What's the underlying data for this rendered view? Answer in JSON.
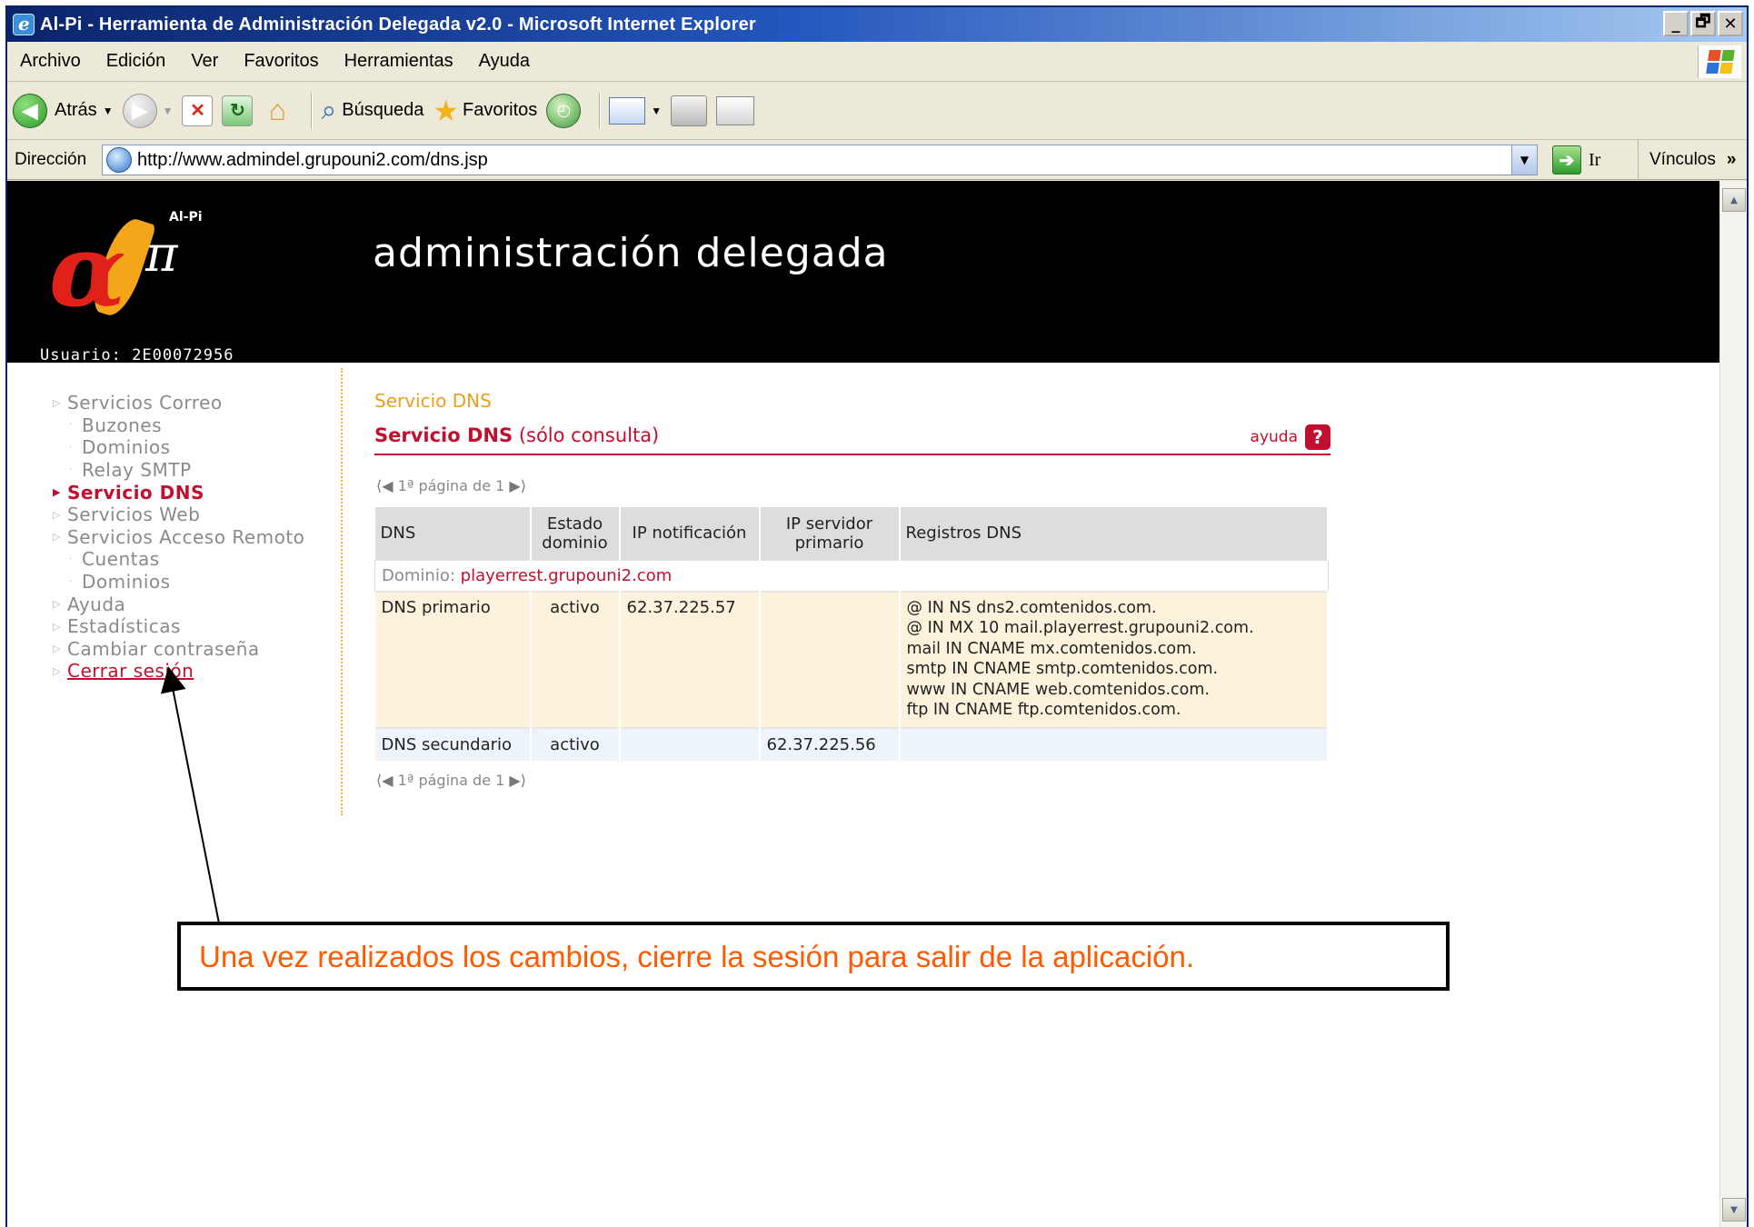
{
  "window": {
    "title": "Al-Pi - Herramienta de Administración Delegada v2.0 - Microsoft Internet Explorer",
    "controls": [
      "_",
      "🗗",
      "✕"
    ]
  },
  "menu": [
    "Archivo",
    "Edición",
    "Ver",
    "Favoritos",
    "Herramientas",
    "Ayuda"
  ],
  "toolbar": {
    "back_label": "Atrás",
    "search_label": "Búsqueda",
    "favorites_label": "Favoritos"
  },
  "address": {
    "label": "Dirección",
    "url": "http://www.admindel.grupouni2.com/dns.jsp",
    "go_label": "Ir",
    "links_label": "Vínculos"
  },
  "header": {
    "brand": "Al-Pi",
    "heading": "administración delegada",
    "user": "Usuario: 2E00072956"
  },
  "sidebar": {
    "items": [
      {
        "label": "Servicios Correo",
        "level": 0
      },
      {
        "label": "Buzones",
        "level": 1
      },
      {
        "label": "Dominios",
        "level": 1
      },
      {
        "label": "Relay SMTP",
        "level": 1
      },
      {
        "label": "Servicio DNS",
        "level": 0,
        "active": true
      },
      {
        "label": "Servicios Web",
        "level": 0
      },
      {
        "label": "Servicios Acceso Remoto",
        "level": 0
      },
      {
        "label": "Cuentas",
        "level": 1
      },
      {
        "label": "Dominios",
        "level": 1
      },
      {
        "label": "Ayuda",
        "level": 0
      },
      {
        "label": "Estadísticas",
        "level": 0
      },
      {
        "label": "Cambiar contraseña",
        "level": 0
      },
      {
        "label": "Cerrar sesión",
        "level": 0,
        "logout": true
      }
    ]
  },
  "content": {
    "crumb": "Servicio DNS",
    "section_title_bold": "Servicio DNS",
    "section_title_rest": "(sólo consulta)",
    "help_label": "ayuda",
    "pager_text": "1ª página de 1",
    "table": {
      "headers": [
        "DNS",
        "Estado dominio",
        "IP notificación",
        "IP servidor primario",
        "Registros DNS"
      ],
      "domain_label": "Dominio:",
      "domain_value": "playerrest.grupouni2.com",
      "rows": [
        {
          "dns": "DNS primario",
          "estado": "activo",
          "ip_notif": "62.37.225.57",
          "ip_primario": "",
          "registros": [
            "@ IN NS dns2.comtenidos.com.",
            "@ IN MX 10 mail.playerrest.grupouni2.com.",
            "mail IN CNAME mx.comtenidos.com.",
            "smtp IN CNAME smtp.comtenidos.com.",
            "www IN CNAME web.comtenidos.com.",
            "ftp IN CNAME ftp.comtenidos.com."
          ]
        },
        {
          "dns": "DNS secundario",
          "estado": "activo",
          "ip_notif": "",
          "ip_primario": "62.37.225.56",
          "registros": []
        }
      ]
    }
  },
  "annotation": {
    "text": "Una vez realizados los cambios, cierre la sesión para salir de la aplicación."
  }
}
